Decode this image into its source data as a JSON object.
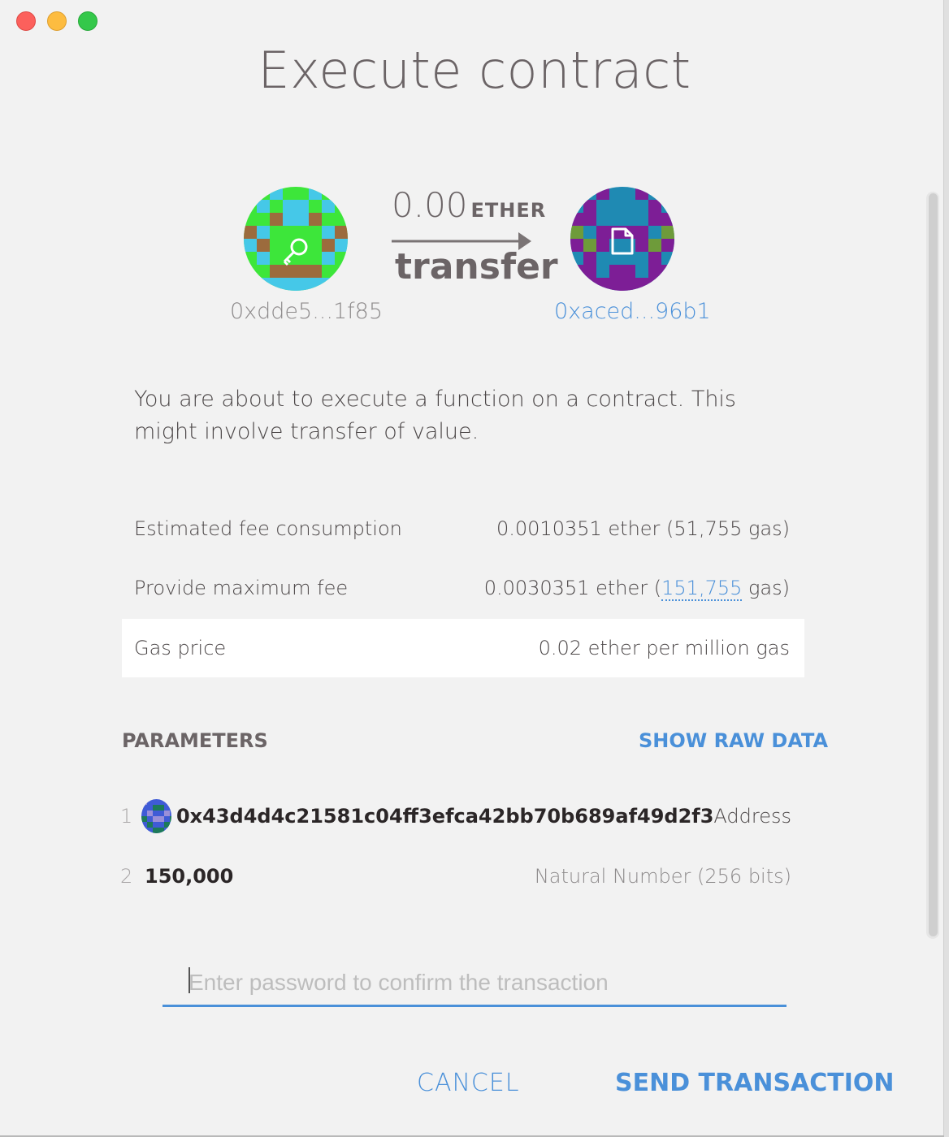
{
  "window": {
    "title": "Execute contract"
  },
  "transfer": {
    "amount": "0.00",
    "unit": "ETHER",
    "method": "transfer",
    "from_address": "0xdde5...1f85",
    "to_address": "0xaced...96b1",
    "from_icon": "key-icon",
    "to_icon": "document-icon"
  },
  "description": "You are about to execute a function on a contract. This might involve transfer of value.",
  "fees": {
    "estimated_label": "Estimated fee consumption",
    "estimated_value": "0.0010351 ether (51,755 gas)",
    "max_label": "Provide maximum fee",
    "max_prefix": "0.0030351 ether (",
    "max_gas": "151,755",
    "max_suffix": " gas)",
    "gas_price_label": "Gas price",
    "gas_price_value": "0.02 ether per million gas"
  },
  "parameters": {
    "heading": "PARAMETERS",
    "show_raw_label": "SHOW RAW DATA",
    "items": [
      {
        "index": "1",
        "value": "0x43d4d4c21581c04ff3efca42bb70b689af49d2f3",
        "type": "Address"
      },
      {
        "index": "2",
        "value": "150,000",
        "type": "Natural Number (256 bits)"
      }
    ]
  },
  "password": {
    "placeholder": "Enter password to confirm the transaction"
  },
  "actions": {
    "cancel": "CANCEL",
    "send": "SEND TRANSACTION"
  },
  "colors": {
    "accent": "#4a90d9",
    "background": "#f2f2f2"
  }
}
